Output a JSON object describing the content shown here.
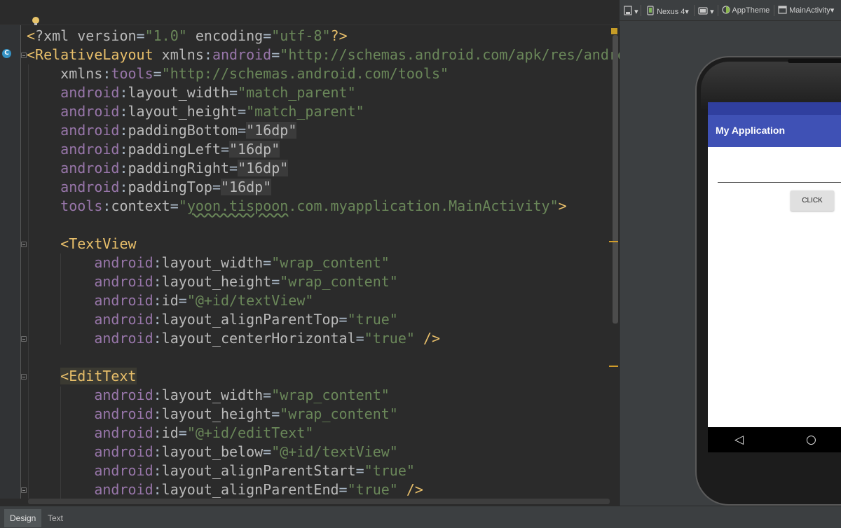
{
  "editor": {
    "lines": [
      [
        [
          "p",
          "<"
        ],
        [
          "a",
          "?xml version"
        ],
        [
          "c",
          "="
        ],
        [
          "v",
          "\"1.0\""
        ],
        [
          "c",
          " "
        ],
        [
          "a",
          "encoding"
        ],
        [
          "c",
          "="
        ],
        [
          "v",
          "\"utf-8\""
        ],
        [
          "p",
          "?>"
        ]
      ],
      [
        [
          "p",
          "<RelativeLayout"
        ],
        [
          "c",
          " "
        ],
        [
          "a",
          "xmlns"
        ],
        [
          "c",
          ":"
        ],
        [
          "ns",
          "android"
        ],
        [
          "c",
          "="
        ],
        [
          "v",
          "\"http://schemas.android.com/apk/res/android\""
        ]
      ],
      [
        [
          "c",
          "    "
        ],
        [
          "a",
          "xmlns"
        ],
        [
          "c",
          ":"
        ],
        [
          "ns",
          "tools"
        ],
        [
          "c",
          "="
        ],
        [
          "v",
          "\"http://schemas.android.com/tools\""
        ]
      ],
      [
        [
          "c",
          "    "
        ],
        [
          "ns",
          "android"
        ],
        [
          "c",
          ":"
        ],
        [
          "a",
          "layout_width"
        ],
        [
          "c",
          "="
        ],
        [
          "v",
          "\"match_parent\""
        ]
      ],
      [
        [
          "c",
          "    "
        ],
        [
          "ns",
          "android"
        ],
        [
          "c",
          ":"
        ],
        [
          "a",
          "layout_height"
        ],
        [
          "c",
          "="
        ],
        [
          "v",
          "\"match_parent\""
        ]
      ],
      [
        [
          "c",
          "    "
        ],
        [
          "ns",
          "android"
        ],
        [
          "c",
          ":"
        ],
        [
          "a",
          "paddingBottom"
        ],
        [
          "c",
          "="
        ],
        [
          "hl",
          "\"16dp\""
        ]
      ],
      [
        [
          "c",
          "    "
        ],
        [
          "ns",
          "android"
        ],
        [
          "c",
          ":"
        ],
        [
          "a",
          "paddingLeft"
        ],
        [
          "c",
          "="
        ],
        [
          "hl",
          "\"16dp\""
        ]
      ],
      [
        [
          "c",
          "    "
        ],
        [
          "ns",
          "android"
        ],
        [
          "c",
          ":"
        ],
        [
          "a",
          "paddingRight"
        ],
        [
          "c",
          "="
        ],
        [
          "hl",
          "\"16dp\""
        ]
      ],
      [
        [
          "c",
          "    "
        ],
        [
          "ns",
          "android"
        ],
        [
          "c",
          ":"
        ],
        [
          "a",
          "paddingTop"
        ],
        [
          "c",
          "="
        ],
        [
          "hl",
          "\"16dp\""
        ]
      ],
      [
        [
          "c",
          "    "
        ],
        [
          "ns",
          "tools"
        ],
        [
          "c",
          ":"
        ],
        [
          "a",
          "context"
        ],
        [
          "c",
          "="
        ],
        [
          "v",
          "\""
        ],
        [
          "sq",
          "yoon.tispoon"
        ],
        [
          "v",
          ".com.myapplication.MainActivity\""
        ],
        [
          "p",
          ">"
        ]
      ],
      [
        [
          "c",
          ""
        ]
      ],
      [
        [
          "c",
          "    "
        ],
        [
          "p",
          "<TextView"
        ]
      ],
      [
        [
          "c",
          "        "
        ],
        [
          "ns",
          "android"
        ],
        [
          "c",
          ":"
        ],
        [
          "a",
          "layout_width"
        ],
        [
          "c",
          "="
        ],
        [
          "v",
          "\"wrap_content\""
        ]
      ],
      [
        [
          "c",
          "        "
        ],
        [
          "ns",
          "android"
        ],
        [
          "c",
          ":"
        ],
        [
          "a",
          "layout_height"
        ],
        [
          "c",
          "="
        ],
        [
          "v",
          "\"wrap_content\""
        ]
      ],
      [
        [
          "c",
          "        "
        ],
        [
          "ns",
          "android"
        ],
        [
          "c",
          ":"
        ],
        [
          "a",
          "id"
        ],
        [
          "c",
          "="
        ],
        [
          "v",
          "\"@+id/textView\""
        ]
      ],
      [
        [
          "c",
          "        "
        ],
        [
          "ns",
          "android"
        ],
        [
          "c",
          ":"
        ],
        [
          "a",
          "layout_alignParentTop"
        ],
        [
          "c",
          "="
        ],
        [
          "v",
          "\"true\""
        ]
      ],
      [
        [
          "c",
          "        "
        ],
        [
          "ns",
          "android"
        ],
        [
          "c",
          ":"
        ],
        [
          "a",
          "layout_centerHorizontal"
        ],
        [
          "c",
          "="
        ],
        [
          "v",
          "\"true\""
        ],
        [
          "c",
          " "
        ],
        [
          "p",
          "/>"
        ]
      ],
      [
        [
          "c",
          ""
        ]
      ],
      [
        [
          "c",
          "    "
        ],
        [
          "tb",
          "<EditText"
        ]
      ],
      [
        [
          "c",
          "        "
        ],
        [
          "ns",
          "android"
        ],
        [
          "c",
          ":"
        ],
        [
          "a",
          "layout_width"
        ],
        [
          "c",
          "="
        ],
        [
          "v",
          "\"wrap_content\""
        ]
      ],
      [
        [
          "c",
          "        "
        ],
        [
          "ns",
          "android"
        ],
        [
          "c",
          ":"
        ],
        [
          "a",
          "layout_height"
        ],
        [
          "c",
          "="
        ],
        [
          "v",
          "\"wrap_content\""
        ]
      ],
      [
        [
          "c",
          "        "
        ],
        [
          "ns",
          "android"
        ],
        [
          "c",
          ":"
        ],
        [
          "a",
          "id"
        ],
        [
          "c",
          "="
        ],
        [
          "v",
          "\"@+id/editText\""
        ]
      ],
      [
        [
          "c",
          "        "
        ],
        [
          "ns",
          "android"
        ],
        [
          "c",
          ":"
        ],
        [
          "a",
          "layout_below"
        ],
        [
          "c",
          "="
        ],
        [
          "v",
          "\"@+id/textView\""
        ]
      ],
      [
        [
          "c",
          "        "
        ],
        [
          "ns",
          "android"
        ],
        [
          "c",
          ":"
        ],
        [
          "a",
          "layout_alignParentStart"
        ],
        [
          "c",
          "="
        ],
        [
          "v",
          "\"true\""
        ]
      ],
      [
        [
          "c",
          "        "
        ],
        [
          "ns",
          "android"
        ],
        [
          "c",
          ":"
        ],
        [
          "a",
          "layout_alignParentEnd"
        ],
        [
          "c",
          "="
        ],
        [
          "v",
          "\"true\""
        ],
        [
          "c",
          " "
        ],
        [
          "p",
          "/>"
        ]
      ]
    ]
  },
  "bottom_tabs": {
    "design": "Design",
    "text": "Text"
  },
  "toolbar": {
    "device": "Nexus 4",
    "theme": "AppTheme",
    "activity": "MainActivity",
    "dropdown_glyph": "▾"
  },
  "phone": {
    "app_title": "My Application",
    "button_label": "CLICK",
    "nav_back": "◁",
    "nav_home": "○",
    "colors": {
      "status_bar": "#303f9f",
      "app_bar": "#3f51b5"
    }
  },
  "gutter": {
    "class_badge": "C"
  }
}
